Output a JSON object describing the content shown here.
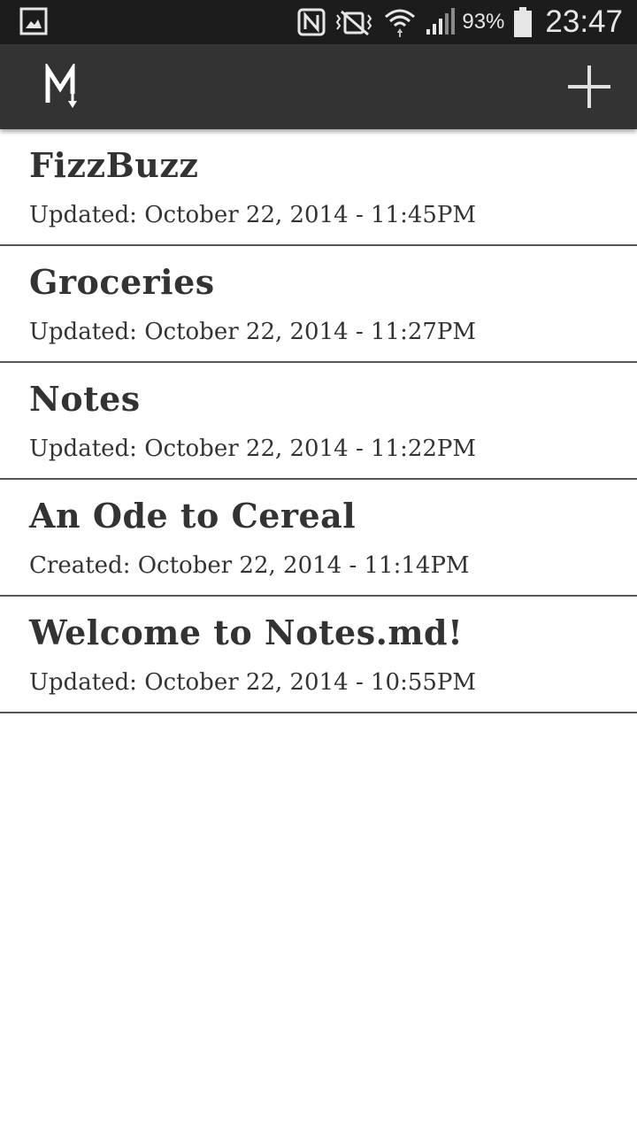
{
  "status_bar": {
    "battery_percent": "93%",
    "time": "23:47",
    "icons": [
      "gallery-icon",
      "nfc-icon",
      "vibrate-icon",
      "wifi-icon",
      "signal-icon",
      "battery-icon"
    ]
  },
  "app_bar": {
    "logo_icon": "markdown-logo-icon",
    "add_icon": "plus-icon"
  },
  "notes": [
    {
      "title": "FizzBuzz",
      "meta": "Updated: October 22, 2014 - 11:45PM"
    },
    {
      "title": "Groceries",
      "meta": "Updated: October 22, 2014 - 11:27PM"
    },
    {
      "title": "Notes",
      "meta": "Updated: October 22, 2014 - 11:22PM"
    },
    {
      "title": "An Ode to Cereal",
      "meta": "Created: October 22, 2014 - 11:14PM"
    },
    {
      "title": "Welcome to Notes.md!",
      "meta": "Updated: October 22, 2014 - 10:55PM"
    }
  ],
  "colors": {
    "status_bar": "#1c1c1c",
    "app_bar": "#333333",
    "text": "#333333",
    "divider": "#555555"
  }
}
